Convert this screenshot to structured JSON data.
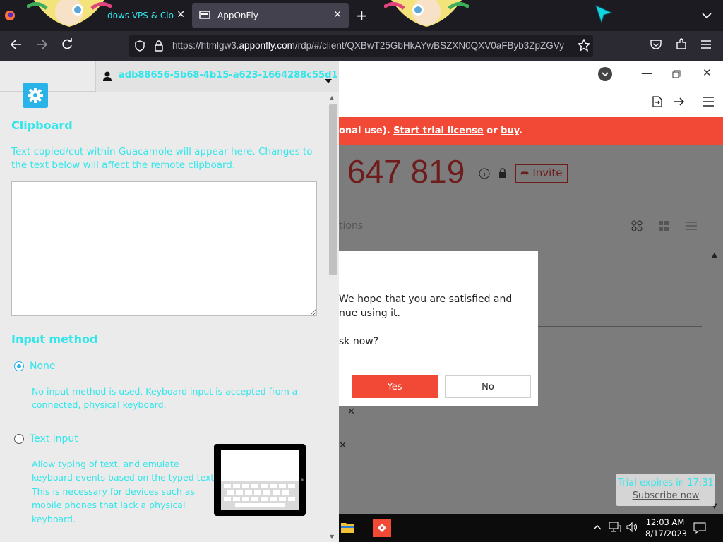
{
  "browser": {
    "tabs": [
      {
        "label": "dows VPS & Clo"
      },
      {
        "label": "AppOnFly"
      }
    ],
    "new_tab": "+",
    "url": {
      "prefix": "https://htmlgw3.",
      "host": "apponfly.com",
      "path": "/rdp/#/client/QXBwT25GbHkAYwBSZXN0QXV0aFByb3ZpZGVy"
    }
  },
  "guac": {
    "username": "adb88656-5b68-4b15-a623-1664288c55d1",
    "clipboard": {
      "title": "Clipboard",
      "desc_line1": "Text copied/cut within Guacamole will appear here. Changes to",
      "desc_line2": "the text below will affect the remote clipboard.",
      "value": ""
    },
    "input_method": {
      "title": "Input method",
      "none": {
        "label": "None",
        "desc_line1": "No input method is used. Keyboard input is accepted from a",
        "desc_line2": "connected, physical keyboard."
      },
      "text_input": {
        "label": "Text input",
        "desc_lines": [
          "Allow typing of text, and emulate",
          "keyboard events based on the typed text.",
          "This is necessary for devices such as",
          "mobile phones that lack a physical",
          "keyboard."
        ]
      }
    }
  },
  "remote": {
    "banner": {
      "prefix": "onal use).",
      "link1": "Start trial license",
      "middle": "or",
      "link2": "buy",
      "suffix": "."
    },
    "id_number": "647 819",
    "invite_label": "Invite",
    "tab_fragment": "tions",
    "dialog": {
      "line1": "We hope that you are satisfied and",
      "line2": "nue using it.",
      "line3": "sk now?",
      "yes": "Yes",
      "no": "No"
    },
    "taskbar": {
      "time": "12:03 AM",
      "date": "8/17/2023"
    }
  },
  "trial": {
    "expires": "Trial expires in 17:31",
    "subscribe": "Subscribe now"
  }
}
